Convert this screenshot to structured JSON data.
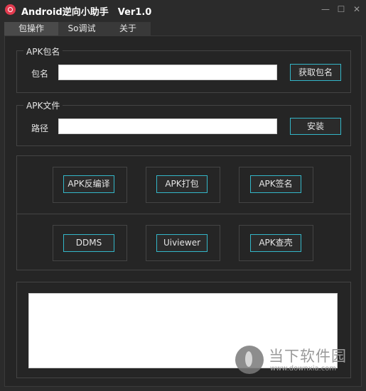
{
  "window": {
    "title": "Android逆向小助手　Ver1.0",
    "minimize": "—",
    "maximize": "☐",
    "close": "✕"
  },
  "tabs": [
    {
      "label": "包操作",
      "selected": true
    },
    {
      "label": "So调试",
      "selected": false
    },
    {
      "label": "关于",
      "selected": false
    }
  ],
  "apk_name_group": {
    "title": "APK包名",
    "field_label": "包名",
    "value": "",
    "button": "获取包名"
  },
  "apk_file_group": {
    "title": "APK文件",
    "field_label": "路径",
    "value": "",
    "button": "安装"
  },
  "tool_buttons_row1": [
    "APK反编译",
    "APK打包",
    "APK签名"
  ],
  "tool_buttons_row2": [
    "DDMS",
    "Uiviewer",
    "APK查壳"
  ],
  "output": {
    "text": ""
  },
  "watermark": {
    "text": "当下软件园",
    "url": "www.downxia.com"
  },
  "colors": {
    "background": "#2b2b2b",
    "button_border": "#33b6c8",
    "textbox": "#ffffff"
  }
}
